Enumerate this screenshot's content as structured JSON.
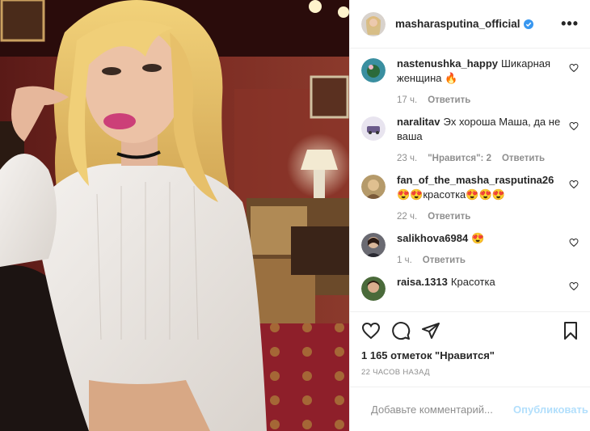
{
  "post": {
    "username": "masharasputina_official",
    "verified_icon": "verified-badge-icon",
    "more_label": "•••"
  },
  "comments": [
    {
      "user": "nastenushka_happy",
      "text": "Шикарная женщина 🔥",
      "time": "17 ч.",
      "likes": "",
      "reply": "Ответить"
    },
    {
      "user": "naralitav",
      "text": "Эх хороша Маша, да не ваша",
      "time": "23 ч.",
      "likes": "\"Нравится\": 2",
      "reply": "Ответить"
    },
    {
      "user": "fan_of_the_masha_rasputina26",
      "text": "😍😍красотка😍😍😍",
      "time": "22 ч.",
      "likes": "",
      "reply": "Ответить"
    },
    {
      "user": "salikhova6984",
      "text": "😍",
      "time": "1 ч.",
      "likes": "",
      "reply": "Ответить"
    },
    {
      "user": "raisa.1313",
      "text": "Красотка",
      "time": "",
      "likes": "",
      "reply": ""
    }
  ],
  "actions": {
    "likes_text": "1 165 отметок \"Нравится\"",
    "date_text": "22 часов назад"
  },
  "add_comment": {
    "placeholder": "Добавьте комментарий...",
    "post_label": "Опубликовать"
  },
  "colors": {
    "accent": "#0095f6",
    "post_disabled": "#b2dffc",
    "meta": "#8e8e8e"
  }
}
